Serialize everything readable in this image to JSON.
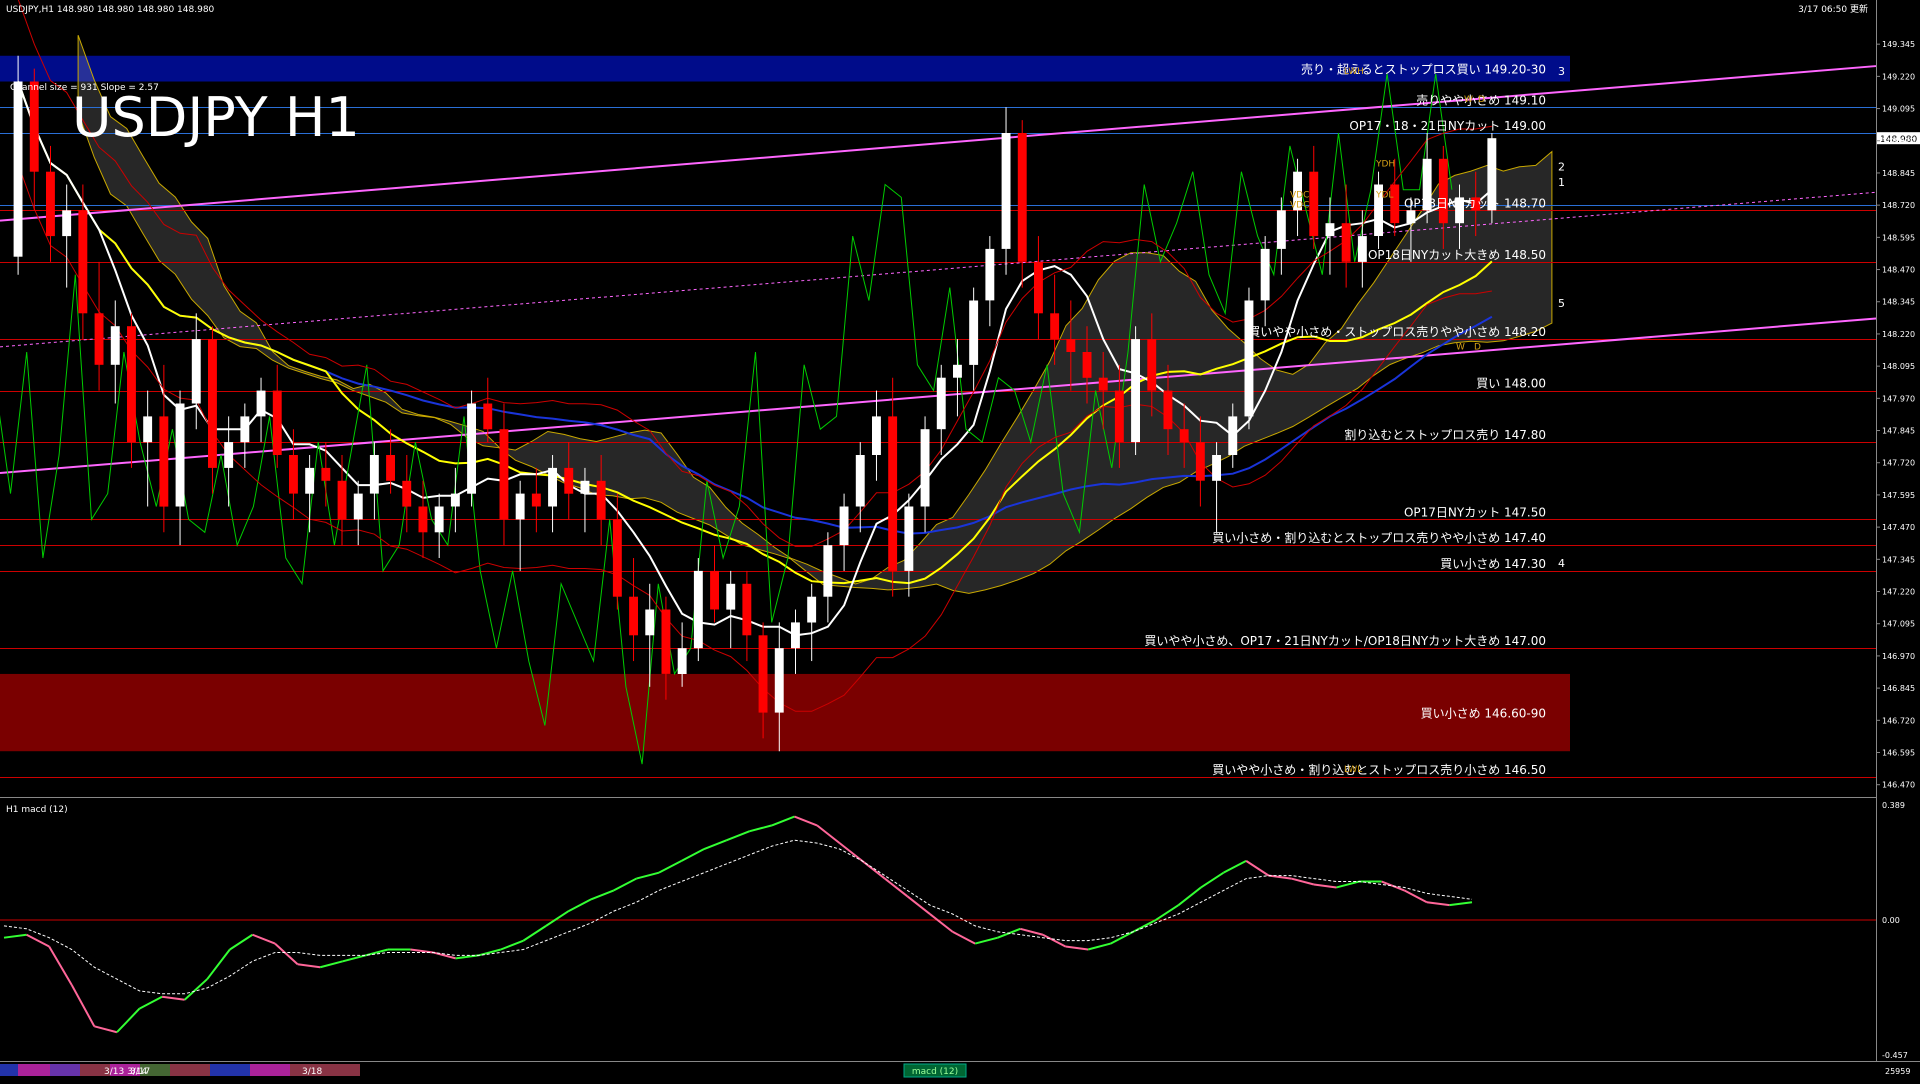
{
  "header": {
    "symbol_info": "USDJPY,H1  148.980 148.980 148.980 148.980",
    "timestamp": "3/17 06:50 更新",
    "watermark": "USDJPY H1",
    "channel_info": "Channel size = 931 Slope = 2.57"
  },
  "colors": {
    "background": "#000000",
    "bull_candle": "#ffffff",
    "bear_candle": "#ff0000",
    "sell_zone": "#000c8a",
    "buy_zone": "#7a0000",
    "cloud": "#d9d9d9",
    "ma_fast": "#ffffff",
    "ma_mid": "#ffff00",
    "ma_slow": "#1a34d9",
    "channel": "#ff66ff",
    "chikou": "#00cc00",
    "macd_up": "#33ff33",
    "macd_down": "#ff6699"
  },
  "chart_data": [
    {
      "type": "line",
      "panel": "price",
      "ylim": [
        146.43,
        149.4
      ],
      "y_ticks": [
        "149.345",
        "149.220",
        "149.095",
        "148.970",
        "148.845",
        "148.720",
        "148.595",
        "148.470",
        "148.345",
        "148.220",
        "148.095",
        "147.970",
        "147.845",
        "147.720",
        "147.595",
        "147.470",
        "147.345",
        "147.220",
        "147.095",
        "146.970",
        "146.845",
        "146.720",
        "146.595",
        "146.470"
      ],
      "current_price": "148.980",
      "zones": [
        {
          "label": "売り・超えるとストップロス買い 149.20-30",
          "from": 149.2,
          "to": 149.3,
          "side": "sell"
        },
        {
          "label": "買い小さめ 146.60-90",
          "from": 146.6,
          "to": 146.9,
          "side": "buy"
        }
      ],
      "levels": [
        {
          "price": 149.1,
          "label": "売りやや小さめ 149.10"
        },
        {
          "price": 149.0,
          "label": "OP17・18・21日NYカット 149.00"
        },
        {
          "price": 148.7,
          "label": "OP18日NYカット 148.70"
        },
        {
          "price": 148.5,
          "label": "OP18日NYカット大きめ 148.50"
        },
        {
          "price": 148.2,
          "label": "買いやや小さめ・ストップロス売りやや小さめ 148.20"
        },
        {
          "price": 148.0,
          "label": "買い 148.00"
        },
        {
          "price": 147.8,
          "label": "割り込むとストップロス売り 147.80"
        },
        {
          "price": 147.5,
          "label": "OP17日NYカット 147.50"
        },
        {
          "price": 147.4,
          "label": "買い小さめ・割り込むとストップロス売りやや小さめ 147.40"
        },
        {
          "price": 147.3,
          "label": "買い小さめ 147.30"
        },
        {
          "price": 147.0,
          "label": "買いやや小さめ、OP17・21日NYカット/OP18日NYカット大きめ 147.00"
        },
        {
          "price": 146.5,
          "label": "買いやや小さめ・割り込むとストップロス売り小さめ 146.50"
        }
      ],
      "fib_labels": [
        "3",
        "2",
        "1",
        "5",
        "4"
      ],
      "box_labels": [
        "LWH",
        "YDH",
        "YDL",
        "VDC",
        "VDC",
        "LWL",
        "W",
        "D",
        "W",
        "D"
      ],
      "candles": [
        [
          148.52,
          149.3,
          148.45,
          149.2
        ],
        [
          149.2,
          149.25,
          148.7,
          148.85
        ],
        [
          148.85,
          148.95,
          148.5,
          148.6
        ],
        [
          148.6,
          148.8,
          148.4,
          148.7
        ],
        [
          148.7,
          148.8,
          148.2,
          148.3
        ],
        [
          148.3,
          148.5,
          148.0,
          148.1
        ],
        [
          148.1,
          148.35,
          147.95,
          148.25
        ],
        [
          148.25,
          148.3,
          147.7,
          147.8
        ],
        [
          147.8,
          148.0,
          147.55,
          147.9
        ],
        [
          147.9,
          148.1,
          147.45,
          147.55
        ],
        [
          147.55,
          148.0,
          147.4,
          147.95
        ],
        [
          147.95,
          148.3,
          147.85,
          148.2
        ],
        [
          148.2,
          148.25,
          147.6,
          147.7
        ],
        [
          147.7,
          147.9,
          147.55,
          147.8
        ],
        [
          147.8,
          147.95,
          147.7,
          147.9
        ],
        [
          147.9,
          148.05,
          147.8,
          148.0
        ],
        [
          148.0,
          148.1,
          147.7,
          147.75
        ],
        [
          147.75,
          147.85,
          147.5,
          147.6
        ],
        [
          147.6,
          147.75,
          147.45,
          147.7
        ],
        [
          147.7,
          147.8,
          147.55,
          147.65
        ],
        [
          147.65,
          147.75,
          147.4,
          147.5
        ],
        [
          147.5,
          147.65,
          147.4,
          147.6
        ],
        [
          147.6,
          147.8,
          147.5,
          147.75
        ],
        [
          147.75,
          147.85,
          147.6,
          147.65
        ],
        [
          147.65,
          147.75,
          147.45,
          147.55
        ],
        [
          147.55,
          147.65,
          147.35,
          147.45
        ],
        [
          147.45,
          147.6,
          147.35,
          147.55
        ],
        [
          147.55,
          147.7,
          147.45,
          147.6
        ],
        [
          147.6,
          148.0,
          147.55,
          147.95
        ],
        [
          147.95,
          148.05,
          147.8,
          147.85
        ],
        [
          147.85,
          147.95,
          147.4,
          147.5
        ],
        [
          147.5,
          147.65,
          147.3,
          147.6
        ],
        [
          147.6,
          147.7,
          147.45,
          147.55
        ],
        [
          147.55,
          147.75,
          147.45,
          147.7
        ],
        [
          147.7,
          147.8,
          147.5,
          147.6
        ],
        [
          147.6,
          147.7,
          147.45,
          147.65
        ],
        [
          147.65,
          147.75,
          147.4,
          147.5
        ],
        [
          147.5,
          147.6,
          147.15,
          147.2
        ],
        [
          147.2,
          147.35,
          146.95,
          147.05
        ],
        [
          147.05,
          147.25,
          146.85,
          147.15
        ],
        [
          147.15,
          147.2,
          146.8,
          146.9
        ],
        [
          146.9,
          147.1,
          146.85,
          147.0
        ],
        [
          147.0,
          147.35,
          146.95,
          147.3
        ],
        [
          147.3,
          147.4,
          147.1,
          147.15
        ],
        [
          147.15,
          147.3,
          147.0,
          147.25
        ],
        [
          147.25,
          147.3,
          146.95,
          147.05
        ],
        [
          147.05,
          147.1,
          146.65,
          146.75
        ],
        [
          146.75,
          147.1,
          146.6,
          147.0
        ],
        [
          147.0,
          147.15,
          146.9,
          147.1
        ],
        [
          147.1,
          147.25,
          146.95,
          147.2
        ],
        [
          147.2,
          147.45,
          147.1,
          147.4
        ],
        [
          147.4,
          147.6,
          147.3,
          147.55
        ],
        [
          147.55,
          147.8,
          147.45,
          147.75
        ],
        [
          147.75,
          148.0,
          147.65,
          147.9
        ],
        [
          147.9,
          148.05,
          147.2,
          147.3
        ],
        [
          147.3,
          147.6,
          147.2,
          147.55
        ],
        [
          147.55,
          147.9,
          147.45,
          147.85
        ],
        [
          147.85,
          148.1,
          147.75,
          148.05
        ],
        [
          148.05,
          148.2,
          147.9,
          148.1
        ],
        [
          148.1,
          148.4,
          148.0,
          148.35
        ],
        [
          148.35,
          148.6,
          148.25,
          148.55
        ],
        [
          148.55,
          149.1,
          148.45,
          149.0
        ],
        [
          149.0,
          149.05,
          148.4,
          148.5
        ],
        [
          148.5,
          148.6,
          148.2,
          148.3
        ],
        [
          148.3,
          148.45,
          148.1,
          148.2
        ],
        [
          148.2,
          148.35,
          148.0,
          148.15
        ],
        [
          148.15,
          148.25,
          147.95,
          148.05
        ],
        [
          148.05,
          148.15,
          147.85,
          148.0
        ],
        [
          148.0,
          148.1,
          147.7,
          147.8
        ],
        [
          147.8,
          148.25,
          147.75,
          148.2
        ],
        [
          148.2,
          148.3,
          147.9,
          148.0
        ],
        [
          148.0,
          148.1,
          147.75,
          147.85
        ],
        [
          147.85,
          147.95,
          147.7,
          147.8
        ],
        [
          147.8,
          147.9,
          147.55,
          147.65
        ],
        [
          147.65,
          147.8,
          147.45,
          147.75
        ],
        [
          147.75,
          147.95,
          147.7,
          147.9
        ],
        [
          147.9,
          148.4,
          147.85,
          148.35
        ],
        [
          148.35,
          148.6,
          148.25,
          148.55
        ],
        [
          148.55,
          148.75,
          148.45,
          148.7
        ],
        [
          148.7,
          148.9,
          148.6,
          148.85
        ],
        [
          148.85,
          148.95,
          148.55,
          148.6
        ],
        [
          148.6,
          148.75,
          148.45,
          148.65
        ],
        [
          148.65,
          148.8,
          148.4,
          148.5
        ],
        [
          148.5,
          148.7,
          148.4,
          148.6
        ],
        [
          148.6,
          148.85,
          148.55,
          148.8
        ],
        [
          148.8,
          148.9,
          148.6,
          148.65
        ],
        [
          148.65,
          148.75,
          148.5,
          148.7
        ],
        [
          148.7,
          149.0,
          148.65,
          148.9
        ],
        [
          148.9,
          148.95,
          148.55,
          148.65
        ],
        [
          148.65,
          148.8,
          148.55,
          148.75
        ],
        [
          148.75,
          148.85,
          148.6,
          148.7
        ],
        [
          148.7,
          149.0,
          148.65,
          148.98
        ]
      ]
    },
    {
      "type": "line",
      "panel": "macd",
      "title": "H1 macd (12)",
      "ylim": [
        -0.457,
        0.389
      ],
      "y_ticks": [
        "0.389",
        "0.00",
        "-0.457"
      ],
      "series": [
        {
          "values": [
            -0.06,
            -0.05,
            -0.09,
            -0.22,
            -0.36,
            -0.38,
            -0.3,
            -0.26,
            -0.27,
            -0.2,
            -0.1,
            -0.05,
            -0.08,
            -0.15,
            -0.16,
            -0.14,
            -0.12,
            -0.1,
            -0.1,
            -0.11,
            -0.13,
            -0.12,
            -0.1,
            -0.07,
            -0.02,
            0.03,
            0.07,
            0.1,
            0.14,
            0.16,
            0.2,
            0.24,
            0.27,
            0.3,
            0.32,
            0.35,
            0.32,
            0.26,
            0.2,
            0.14,
            0.08,
            0.02,
            -0.04,
            -0.08,
            -0.06,
            -0.03,
            -0.05,
            -0.09,
            -0.1,
            -0.08,
            -0.04,
            0.0,
            0.05,
            0.11,
            0.16,
            0.2,
            0.15,
            0.14,
            0.12,
            0.11,
            0.13,
            0.13,
            0.1,
            0.06,
            0.05,
            0.06
          ]
        },
        {
          "values": [
            -0.02,
            -0.03,
            -0.06,
            -0.1,
            -0.16,
            -0.2,
            -0.24,
            -0.25,
            -0.25,
            -0.23,
            -0.19,
            -0.14,
            -0.11,
            -0.11,
            -0.12,
            -0.12,
            -0.12,
            -0.11,
            -0.11,
            -0.11,
            -0.12,
            -0.12,
            -0.11,
            -0.1,
            -0.07,
            -0.04,
            -0.01,
            0.03,
            0.06,
            0.1,
            0.13,
            0.16,
            0.19,
            0.22,
            0.25,
            0.27,
            0.26,
            0.24,
            0.2,
            0.15,
            0.1,
            0.05,
            0.02,
            -0.02,
            -0.04,
            -0.05,
            -0.06,
            -0.07,
            -0.07,
            -0.06,
            -0.04,
            -0.01,
            0.02,
            0.06,
            0.1,
            0.14,
            0.15,
            0.15,
            0.14,
            0.13,
            0.13,
            0.12,
            0.11,
            0.09,
            0.08,
            0.07
          ]
        }
      ]
    }
  ],
  "bottom_bar": {
    "date_labels": [
      "3/13 3/14",
      "3/17",
      "3/18"
    ],
    "indicator_tab": "macd (12)",
    "counter": "25959"
  }
}
